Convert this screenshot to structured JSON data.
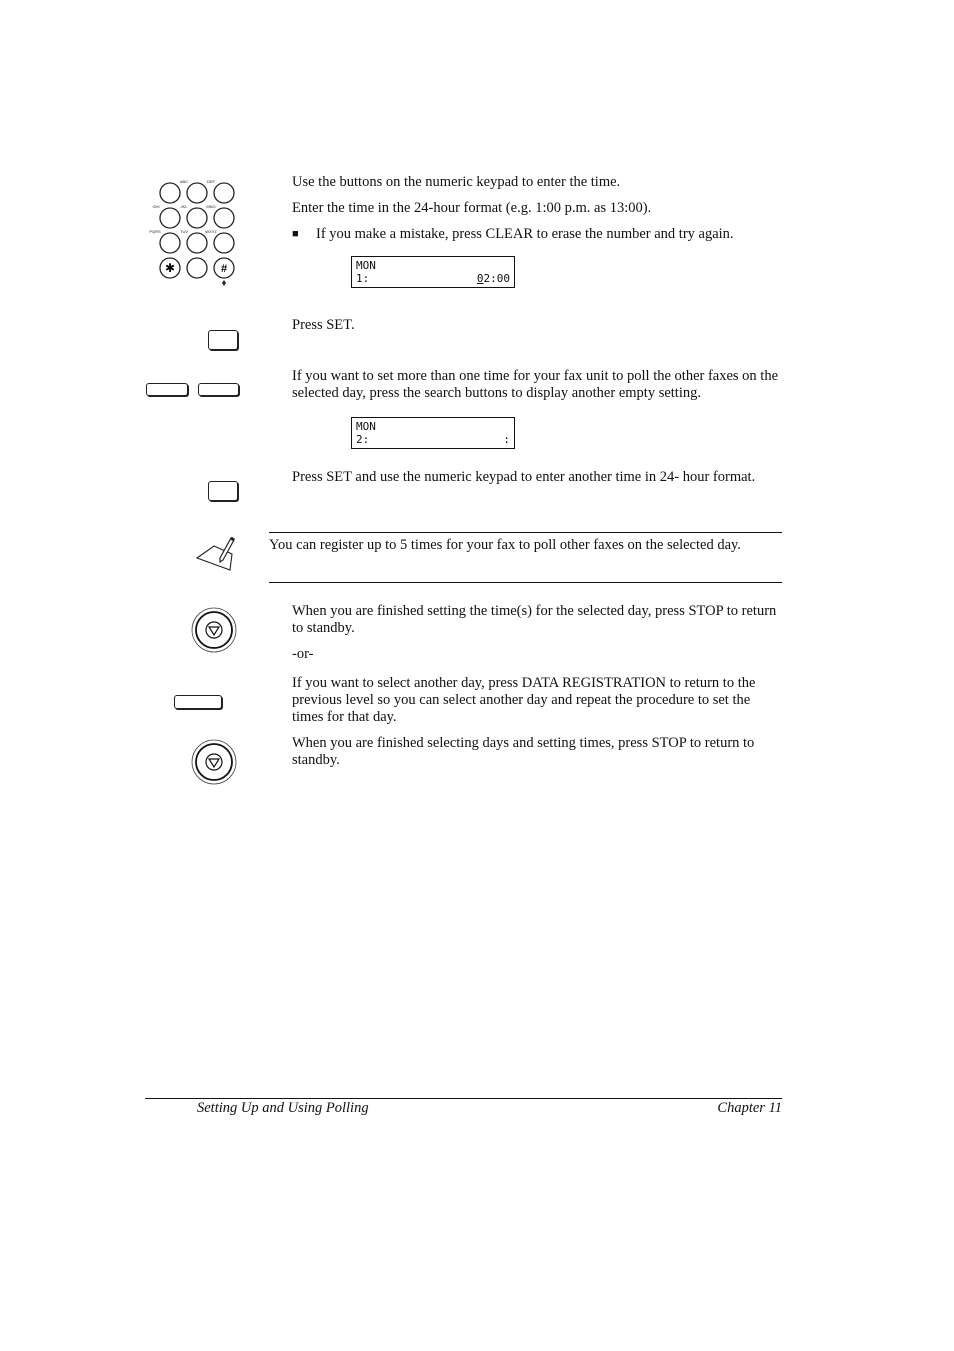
{
  "steps": {
    "keypad_text_1": "Use the buttons on the numeric keypad to enter the time.",
    "keypad_text_2": "Enter the time in the 24-hour format (e.g. 1:00 p.m. as 13:00).",
    "bullet": "■",
    "keypad_bullet": "If you make a mistake, press CLEAR to erase the number and try again.",
    "lcd1": {
      "line1": "MON",
      "line2_left": "1:",
      "line2_right_underlined": "0",
      "line2_right_rest": "2:00"
    },
    "set_text": "Press SET.",
    "search_text": "If you want to set more than one time for your fax unit to poll the other faxes on the selected day, press the search buttons to display another empty setting.",
    "lcd2": {
      "line1": "MON",
      "line2_left": "2:",
      "line2_right": ":"
    },
    "set2_text": "Press SET and use the numeric keypad to enter another time in 24- hour format.",
    "note_text": "You can register up to 5 times for your fax to poll other faxes on the selected day.",
    "stop_text": "When you are finished setting the time(s) for the selected day, press STOP to return to standby.",
    "or_text": "-or-",
    "datareg_text": "If you want to select another day, press DATA REGISTRATION to return to the previous level so you can select another day and repeat the procedure to set the times for that day.",
    "stop2_text": "When you are finished selecting days and setting times, press STOP to return to standby."
  },
  "keypad": {
    "labels": [
      "ABC",
      "DEF",
      "GHI",
      "JKL",
      "MNO",
      "PQRS",
      "TUV",
      "WXYZ"
    ],
    "star": "✱",
    "hash": "#"
  },
  "footer": {
    "left": "Setting Up and Using Polling",
    "right": "Chapter 11"
  }
}
